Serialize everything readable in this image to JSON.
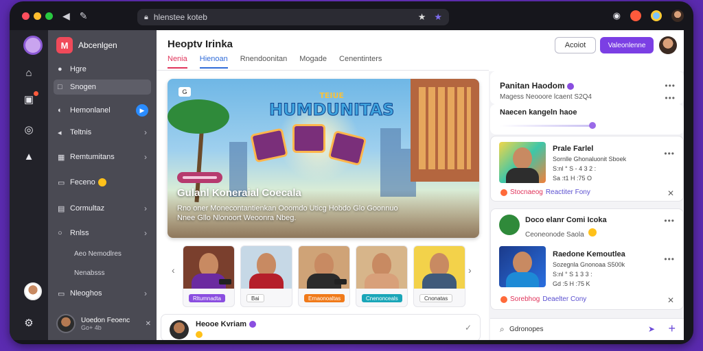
{
  "browser": {
    "url": "hlenstee koteb",
    "dot_colors": [
      "#ff4f5e",
      "#ffbd2e",
      "#28c840"
    ]
  },
  "sidebar": {
    "brand": "Abcenlgen",
    "items": [
      {
        "label": "Hgre",
        "icon": "dot"
      },
      {
        "label": "Snogen",
        "icon": "square",
        "active": true
      },
      {
        "label": "Hemonlanel",
        "icon": "play",
        "live": true
      },
      {
        "label": "Teltnis",
        "icon": "volume",
        "chev": true
      },
      {
        "label": "Remtumitans",
        "icon": "grid",
        "chev": true
      },
      {
        "label": "Feceno",
        "icon": "cal",
        "emoji": true
      },
      {
        "label": "Cormultaz",
        "icon": "table",
        "chev": true
      },
      {
        "label": "Rnlss",
        "icon": "circle",
        "chev": true
      },
      {
        "label": "Aeo Nemodlres",
        "sub": true
      },
      {
        "label": "Nenabsss",
        "sub": true
      },
      {
        "label": "Nleoghos",
        "icon": "cal2",
        "chev": true
      }
    ],
    "user": {
      "name": "Uoedon Feoenc",
      "status": "Go+ 4b"
    }
  },
  "main": {
    "title": "Heoptv Irinka",
    "tabs": [
      "Nenia",
      "Hienoan",
      "Rnendoonitan",
      "Mogade",
      "Cenentinters"
    ],
    "hero": {
      "badge": "G",
      "art_title": "HUMDUNITAS",
      "art_sub": "TEIUE",
      "title": "Gulanl Koneraial Coecala",
      "desc": "Rno oner Monecontantienkan Ooomdo Uticg Hobdo Glo Goonnuo Nnee Gllo Nlonoort Weoonra Nbeg."
    },
    "thumbs": [
      {
        "tag": "Rltumnadta",
        "tag_color": "#8a4ee0",
        "img": "#7a3f2d",
        "body": "#6b2aa0"
      },
      {
        "tag": "Bai",
        "tag_color": "#ffffff",
        "tag_text": "#333",
        "img": "#c6d8e6",
        "body": "#b51f2a"
      },
      {
        "tag": "Ernaonoaltas",
        "tag_color": "#f07a1a",
        "img": "#cfa377",
        "body": "#2b2b2b"
      },
      {
        "tag": "Cnenonceals",
        "tag_color": "#1aa6b8",
        "img": "#d7b58a",
        "body": "#d8a07a"
      },
      {
        "tag": "Cnonatas",
        "tag_color": "#ffffff",
        "tag_text": "#333",
        "img": "#f3d24a",
        "body": "#3f5a7a"
      }
    ],
    "post": {
      "name": "Heooe Kvriam"
    }
  },
  "right": {
    "btn_outline": "Acoiot",
    "btn_primary": "Valeonlenne",
    "card1": {
      "title": "Panitan Haodom",
      "sub": "Magess  Neooore lcaent S2Q4",
      "label": "Naecen kangeln haoe"
    },
    "card2": {
      "name": "Prale Farlel",
      "lines": [
        "Sornlle Ghonaluonit Sboek",
        "S:nl ° S - 4 3 2 :",
        "Sa :t1 H :75 O"
      ],
      "footer_a": "Stocnaeog",
      "footer_b": "Reactiter Fony"
    },
    "card3": {
      "title": "Doco elanr Comi Icoka",
      "sub": "Ceoneonode Saola",
      "name": "Raedone Kemoutlea",
      "lines": [
        "Sozegnla Gnonoaa S500k",
        "S:nl ° S 1 3 3 :",
        "Gd :5 H :75 K"
      ],
      "footer_a": "Sorebhog",
      "footer_b": "Deaelter Cony"
    },
    "search": "Gdronopes"
  }
}
